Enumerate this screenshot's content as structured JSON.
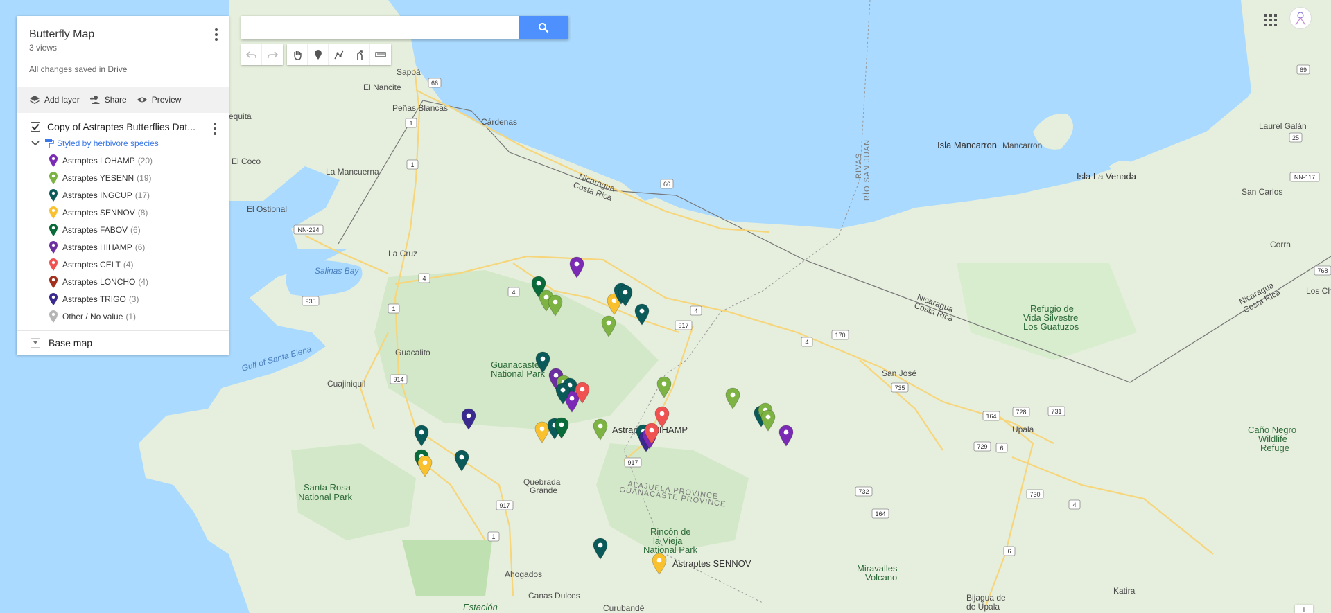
{
  "panel": {
    "title": "Butterfly Map",
    "views": "3 views",
    "saved": "All changes saved in Drive",
    "actions": {
      "add_layer": "Add layer",
      "share": "Share",
      "preview": "Preview"
    },
    "layer": {
      "name": "Copy of Astraptes Butterflies Dat...",
      "styled_by": "Styled by herbivore species",
      "legend": [
        {
          "label": "Astraptes LOHAMP",
          "count": "(20)",
          "color": "#7b2ab5"
        },
        {
          "label": "Astraptes YESENN",
          "count": "(19)",
          "color": "#7cb342"
        },
        {
          "label": "Astraptes INGCUP",
          "count": "(17)",
          "color": "#0b5a5a"
        },
        {
          "label": "Astraptes SENNOV",
          "count": "(8)",
          "color": "#f9c12e"
        },
        {
          "label": "Astraptes FABOV",
          "count": "(6)",
          "color": "#0a6b3a"
        },
        {
          "label": "Astraptes HIHAMP",
          "count": "(6)",
          "color": "#6b2fa0"
        },
        {
          "label": "Astraptes CELT",
          "count": "(4)",
          "color": "#f05252"
        },
        {
          "label": "Astraptes LONCHO",
          "count": "(4)",
          "color": "#a3301c"
        },
        {
          "label": "Astraptes TRIGO",
          "count": "(3)",
          "color": "#3a2a8f"
        },
        {
          "label": "Other / No value",
          "count": "(1)",
          "color": "#b5b5b5"
        }
      ]
    },
    "base_map": "Base map"
  },
  "search": {
    "value": "",
    "placeholder": ""
  },
  "map_labels": {
    "sapoa": "Sapoá",
    "el_nancite": "El Nancite",
    "penas_blancas": "Peñas Blancas",
    "cardenas": "Cárdenas",
    "equita": "equita",
    "el_coco": "El Coco",
    "la_mancuerna": "La Mancuerna",
    "el_ostional": "El Ostional",
    "la_cruz": "La Cruz",
    "salinas_bay": "Salinas Bay",
    "guacalito": "Guacalito",
    "gulf_santa_elena": "Gulf of Santa Elena",
    "cuajiniquil": "Cuajiniquil",
    "guanacaste_np_1": "Guanacaste",
    "guanacaste_np_2": "National Park",
    "santa_rosa_1": "Santa Rosa",
    "santa_rosa_2": "National Park",
    "quebrada_1": "Quebrada",
    "quebrada_2": "Grande",
    "alajuela": "ALAJUELA PROVINCE",
    "guanacaste_prov": "GUANACASTE PROVINCE",
    "rincon_1": "Rincón de",
    "rincon_2": "la Vieja",
    "rincon_3": "National Park",
    "ahogados": "Ahogados",
    "canas_dulces": "Canas Dulces",
    "curubande": "Curubandé",
    "estacion": "Estación",
    "miravalles_1": "Miravalles",
    "miravalles_2": "Volcano",
    "bijagua_1": "Bijagua de",
    "bijagua_2": "de Upala",
    "katira": "Katira",
    "upala": "Upala",
    "san_jose": "San José",
    "refugio_1": "Refugio de",
    "refugio_2": "Vida Silvestre",
    "refugio_3": "Los Guatuzos",
    "cano_negro_1": "Caño Negro",
    "cano_negro_2": "Wildlife",
    "cano_negro_3": "Refuge",
    "isla_mancarron": "Isla Mancarron",
    "mancarron": "Mancarron",
    "isla_venada": "Isla La Venada",
    "san_carlos": "San Carlos",
    "laurel_galan": "Laurel Galán",
    "corra": "Corra",
    "los_ch": "Los Ch",
    "rivas": "RIVAS",
    "rio_san_juan": "RÍO SAN JUAN",
    "nicaragua_cr_1a": "Nicaragua",
    "nicaragua_cr_1b": "Costa Rica",
    "nicaragua_cr_2a": "Nicaragua",
    "nicaragua_cr_2b": "Costa Rica",
    "nicaragua_cr_3a": "Nicaragua",
    "nicaragua_cr_3b": "Costa Rica",
    "marker_label_hihamp": "Astraptes HIHAMP",
    "marker_label_sennov": "Astraptes SENNOV"
  },
  "road_shields": [
    "66",
    "1",
    "1",
    "66",
    "NN-224",
    "4",
    "4",
    "935",
    "1",
    "4",
    "917",
    "4",
    "170",
    "914",
    "735",
    "164",
    "728",
    "731",
    "729",
    "6",
    "917",
    "917",
    "1",
    "732",
    "164",
    "730",
    "4",
    "6",
    "25",
    "69",
    "NN-117",
    "768"
  ],
  "colors": {
    "water": "#aadaff",
    "land": "#e8f0e0",
    "park": "#cfe6c4",
    "search_button": "#4d90fe",
    "link": "#3b78e7"
  }
}
